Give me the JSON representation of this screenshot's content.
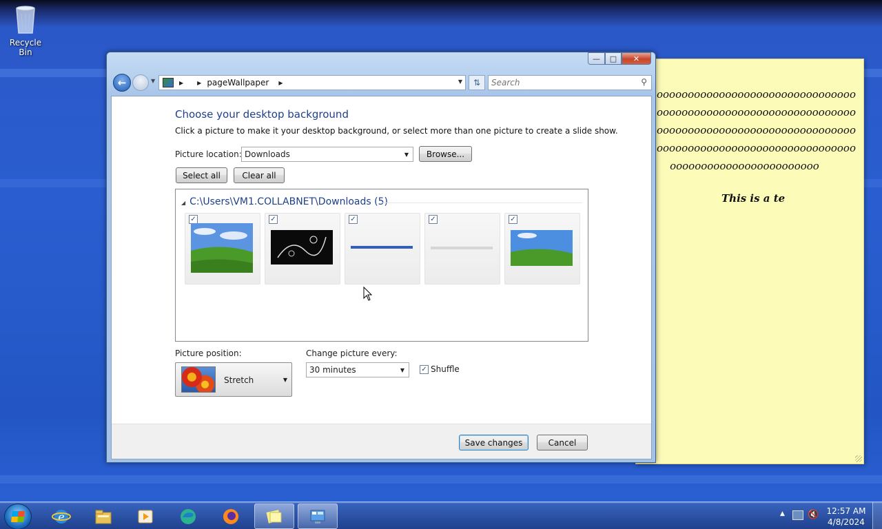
{
  "desktop": {
    "recycle_bin_label": "Recycle Bin"
  },
  "sticky_note": {
    "scribble_lines": [
      "oooooooooooooooooooooooooooooooo",
      "oooooooooooooooooooooooooooooooo",
      "oooooooooooooooooooooooooooooooo",
      "oooooooooooooooooooooooooooooooo",
      "    oooooooooooooooooooooooo"
    ],
    "text": "This is a te"
  },
  "window": {
    "address": {
      "crumb": "pageWallpaper"
    },
    "search_placeholder": "Search",
    "heading": "Choose your desktop background",
    "subheading": "Click a picture to make it your desktop background, or select more than one picture to create a slide show.",
    "picture_location_label": "Picture location:",
    "picture_location_value": "Downloads",
    "browse_label": "Browse...",
    "select_all_label": "Select all",
    "clear_all_label": "Clear all",
    "folder_header": "C:\\Users\\VM1.COLLABNET\\Downloads (5)",
    "thumbnails": [
      {
        "checked": true,
        "kind": "bliss"
      },
      {
        "checked": true,
        "kind": "dark-swirl"
      },
      {
        "checked": true,
        "kind": "blue-bar"
      },
      {
        "checked": true,
        "kind": "white-bar"
      },
      {
        "checked": true,
        "kind": "bliss"
      }
    ],
    "picture_position_label": "Picture position:",
    "picture_position_value": "Stretch",
    "change_every_label": "Change picture every:",
    "change_every_value": "30 minutes",
    "shuffle_label": "Shuffle",
    "shuffle_checked": true,
    "save_label": "Save changes",
    "cancel_label": "Cancel"
  },
  "taskbar": {
    "time": "12:57 AM",
    "date": "4/8/2024",
    "apps": [
      "internet-explorer-icon",
      "file-explorer-icon",
      "media-player-icon",
      "edge-icon",
      "firefox-icon",
      "sticky-notes-icon",
      "control-panel-icon"
    ]
  }
}
